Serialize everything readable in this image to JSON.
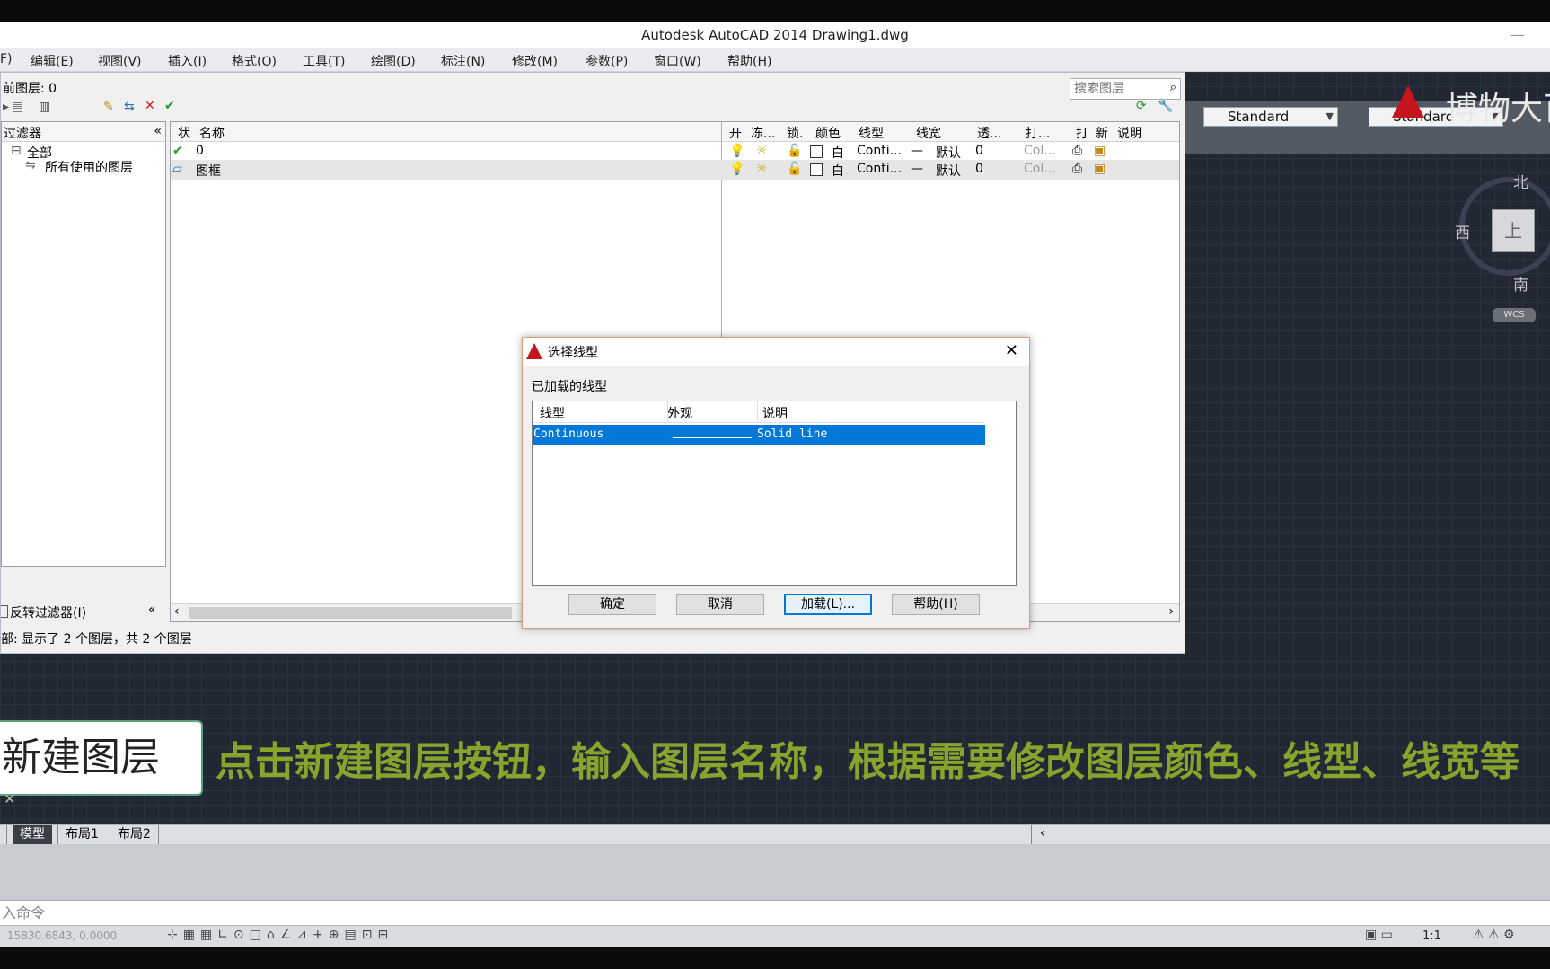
{
  "window": {
    "title": "Autodesk AutoCAD 2014    Drawing1.dwg",
    "minimize_glyph": "—"
  },
  "menu": [
    "F)",
    "编辑(E)",
    "视图(V)",
    "插入(I)",
    "格式(O)",
    "工具(T)",
    "绘图(D)",
    "标注(N)",
    "修改(M)",
    "参数(P)",
    "窗口(W)",
    "帮助(H)"
  ],
  "style_bar": {
    "text_style": "Standard",
    "dim_style": "Standard"
  },
  "logo_text": "博物大百",
  "viewcube": {
    "north": "北",
    "west": "西",
    "south": "南",
    "top_face": "上",
    "wcs": "WCS"
  },
  "layer_manager": {
    "current_layer": "前图层: 0",
    "search_placeholder": "搜索图层",
    "filter_header": "过滤器",
    "filter_tree": [
      "全部",
      "所有使用的图层"
    ],
    "invert_filter": "反转过滤器(I)",
    "status": "部: 显示了 2 个图层，共 2 个图层",
    "columns_left": [
      "状",
      "名称"
    ],
    "columns_right": [
      "开",
      "冻...",
      "锁.",
      "颜色",
      "线型",
      "线宽",
      "透...",
      "打...",
      "打",
      "新",
      "说明"
    ],
    "layers": [
      {
        "status": "✔",
        "name": "0",
        "color": "白",
        "linetype": "Conti...",
        "lineweight": "默认",
        "transparency": "0",
        "plot_style": "Col..."
      },
      {
        "status": "▱",
        "name": "图框",
        "color": "白",
        "linetype": "Conti...",
        "lineweight": "默认",
        "transparency": "0",
        "plot_style": "Col..."
      }
    ]
  },
  "dialog": {
    "title": "选择线型",
    "section_label": "已加载的线型",
    "columns": [
      "线型",
      "外观",
      "说明"
    ],
    "rows": [
      {
        "linetype": "Continuous",
        "description": "Solid line"
      }
    ],
    "buttons": {
      "ok": "确定",
      "cancel": "取消",
      "load": "加载(L)...",
      "help": "帮助(H)"
    }
  },
  "subtitle": {
    "box": "新建图层",
    "text": "点击新建图层按钮，输入图层名称，根据需要修改图层颜色、线型、线宽等"
  },
  "tabs": [
    "模型",
    "布局1",
    "布局2"
  ],
  "command_prompt": "入命令",
  "coordinates": "15830.6843, 0.0000",
  "scale": "1:1",
  "colors": {
    "accent_blue": "#0078d7",
    "subtitle_green": "#86a52c",
    "canvas": "#222833"
  }
}
